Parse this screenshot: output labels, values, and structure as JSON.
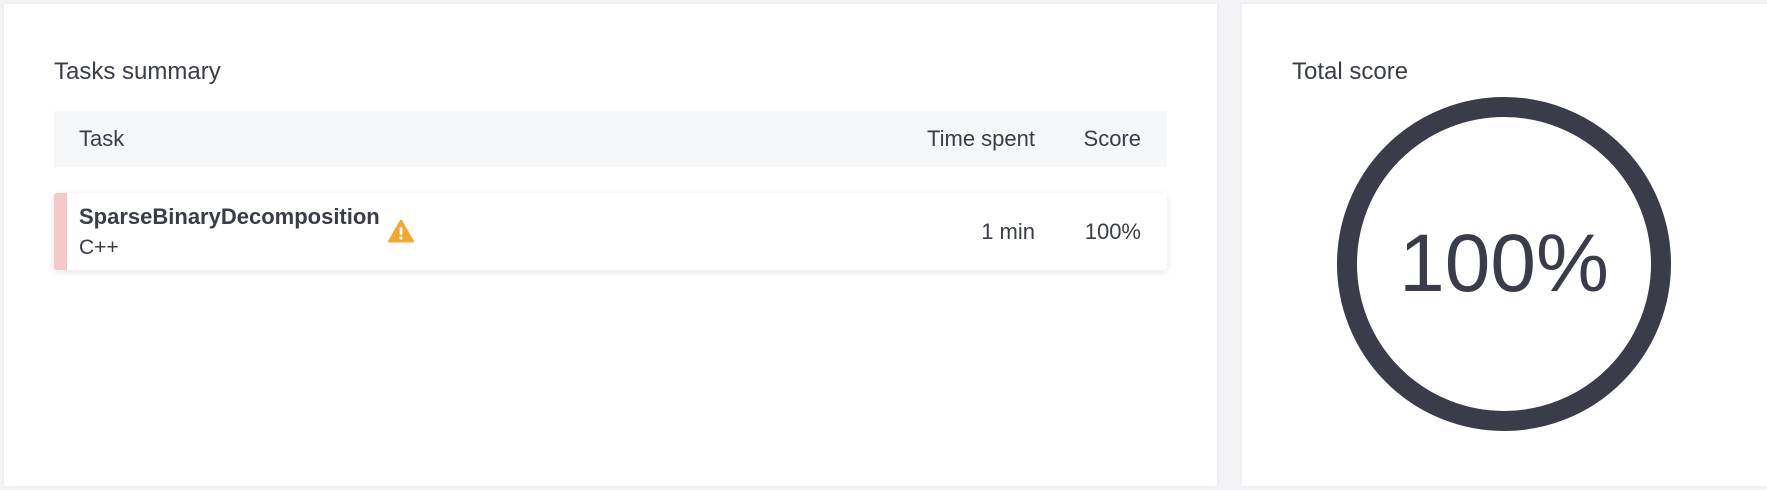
{
  "tasks_summary": {
    "title": "Tasks summary",
    "columns": {
      "task": "Task",
      "time_spent": "Time spent",
      "score": "Score"
    },
    "rows": [
      {
        "name": "SparseBinaryDecomposition",
        "language": "C++",
        "time_spent": "1 min",
        "score": "100%",
        "warning_icon": "warning-triangle-icon",
        "accent_color": "#f4c7c9",
        "warning_color": "#f0a92e"
      }
    ]
  },
  "total_score": {
    "title": "Total score",
    "value": "100%",
    "ring_color": "#3a3c49"
  }
}
